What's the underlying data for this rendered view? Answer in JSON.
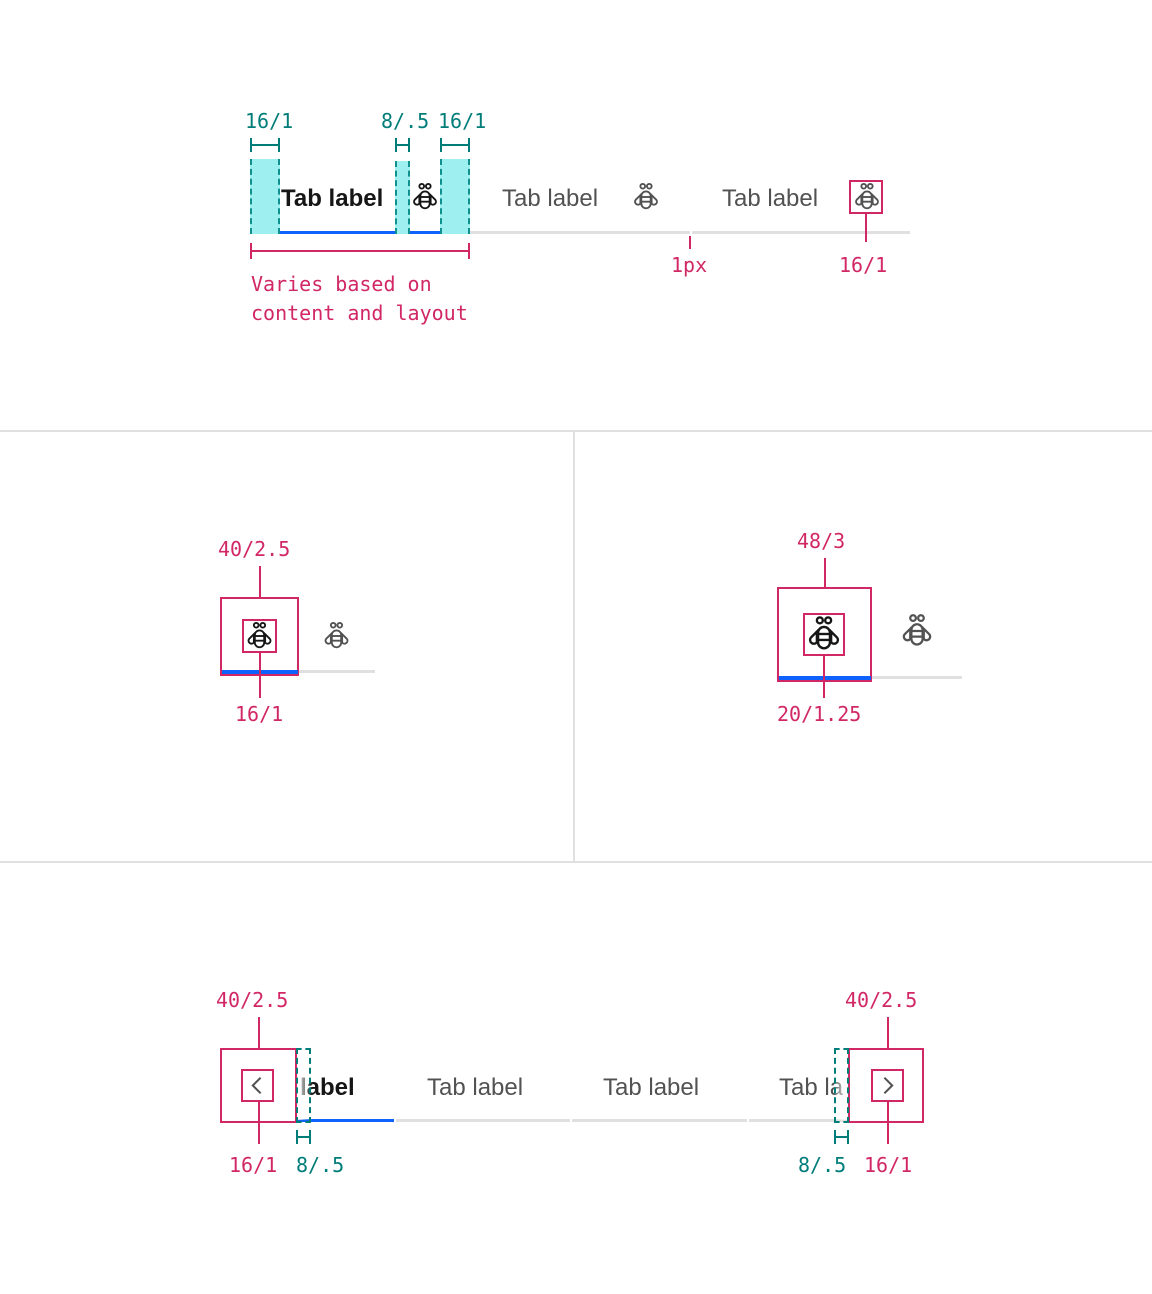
{
  "colors": {
    "spec_magenta": "#d12765",
    "spec_teal": "#007d79",
    "padding_cyan": "#9ef0f0",
    "selected_underline": "#0f62fe",
    "unselected_underline": "#e0e0e0",
    "text_selected": "#161616",
    "text_unselected": "#525252"
  },
  "section_top": {
    "spacing_labels": [
      "16/1",
      "8/.5",
      "16/1"
    ],
    "tabs": [
      {
        "label": "Tab label",
        "selected": true,
        "icon": "bee-icon"
      },
      {
        "label": "Tab label",
        "selected": false,
        "icon": "bee-icon"
      },
      {
        "label": "Tab label",
        "selected": false,
        "icon": "bee-icon"
      }
    ],
    "width_note": "Varies based on\ncontent and layout",
    "border_note": "1px",
    "icon_size_note": "16/1"
  },
  "section_icon_only_default": {
    "container_size": "40/2.5",
    "icon_size": "16/1",
    "icons": [
      "bee-icon",
      "bee-icon"
    ]
  },
  "section_icon_only_large": {
    "container_size": "48/3",
    "icon_size": "20/1.25",
    "icons": [
      "bee-icon",
      "bee-icon"
    ]
  },
  "section_overflow": {
    "left_button_size": "40/2.5",
    "left_icon_size": "16/1",
    "left_gap": "8/.5",
    "right_button_size": "40/2.5",
    "right_icon_size": "16/1",
    "right_gap": "8/.5",
    "tabs": [
      {
        "label": "label",
        "selected": true
      },
      {
        "label": "Tab label",
        "selected": false
      },
      {
        "label": "Tab label",
        "selected": false
      },
      {
        "label": "Tab la",
        "selected": false
      }
    ],
    "left_icon": "chevron-left-icon",
    "right_icon": "chevron-right-icon"
  }
}
